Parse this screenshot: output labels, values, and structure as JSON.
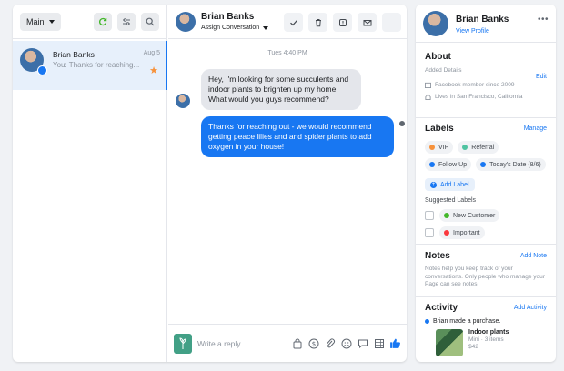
{
  "inbox": {
    "filter_label": "Main",
    "conversation": {
      "name": "Brian Banks",
      "preview": "You: Thanks for reaching...",
      "date": "Aug 5"
    }
  },
  "thread": {
    "contact_name": "Brian Banks",
    "assign_label": "Assign Conversation",
    "timestamp": "Tues 4:40 PM",
    "messages": [
      {
        "direction": "incoming",
        "text": "Hey, I'm looking for some succulents and indoor plants to brighten up my home. What would you guys recommend?"
      },
      {
        "direction": "outgoing",
        "text": "Thanks for reaching out - we would recommend getting peace lilies and and spider plants to add oxygen in your house!"
      }
    ],
    "reply_placeholder": "Write a reply..."
  },
  "profile": {
    "name": "Brian Banks",
    "view_profile": "View Profile",
    "about": {
      "title": "About",
      "added_details": "Added Details",
      "edit": "Edit",
      "member_since": "Facebook member since 2009",
      "lives_in": "Lives in San Francisco, California"
    },
    "labels": {
      "title": "Labels",
      "manage": "Manage",
      "items": [
        {
          "name": "VIP",
          "color": "#f7923b"
        },
        {
          "name": "Referral",
          "color": "#4fc3a1"
        },
        {
          "name": "Follow Up",
          "color": "#1877f2"
        },
        {
          "name": "Today's Date (8/6)",
          "color": "#1877f2"
        }
      ],
      "add_label": "Add Label",
      "suggested_title": "Suggested Labels",
      "suggested": [
        {
          "name": "New Customer",
          "color": "#42b72a"
        },
        {
          "name": "Important",
          "color": "#fa383e"
        }
      ]
    },
    "notes": {
      "title": "Notes",
      "add": "Add Note",
      "help": "Notes help you keep track of your conversations. Only people who manage your Page can see notes."
    },
    "activity": {
      "title": "Activity",
      "add": "Add Activity",
      "event": "Brian made a purchase.",
      "product_name": "Indoor plants",
      "product_meta": "Mini · 3 items",
      "product_price": "$42"
    }
  },
  "colors": {
    "accent": "#1877f2",
    "star": "#f7923b"
  }
}
